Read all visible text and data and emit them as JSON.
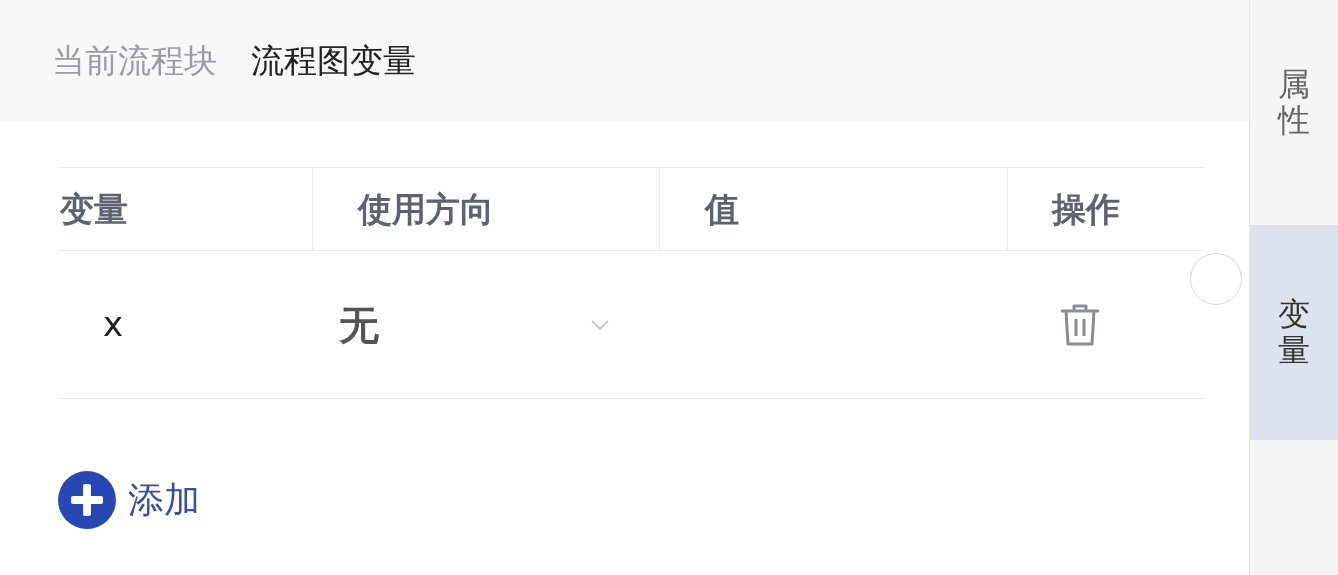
{
  "header": {
    "label": "当前流程块",
    "title": "流程图变量"
  },
  "table": {
    "columns": [
      "变量",
      "使用方向",
      "值",
      "操作"
    ],
    "rows": [
      {
        "variable": "x",
        "direction": "无"
      }
    ]
  },
  "add_button": {
    "label": "添加"
  },
  "side_tabs": [
    {
      "label": "属性",
      "selected": false
    },
    {
      "label": "变量",
      "selected": true
    }
  ]
}
